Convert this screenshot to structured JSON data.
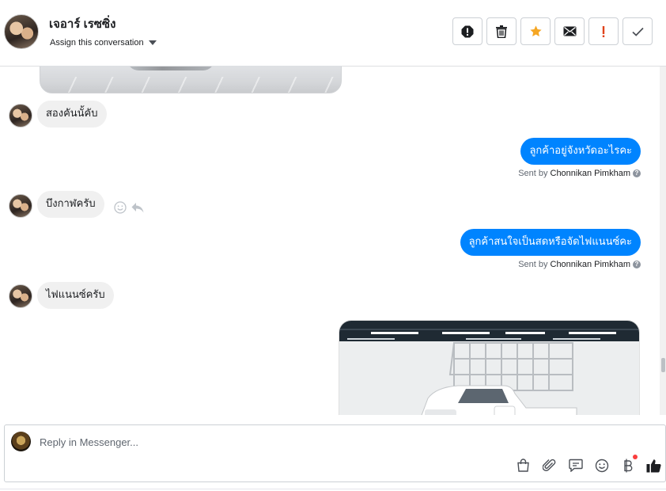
{
  "header": {
    "contact_name": "เจอาร์ เรซซิ่ง",
    "assign_label": "Assign this conversation",
    "actions": [
      {
        "name": "mark-spam-icon"
      },
      {
        "name": "trash-icon"
      },
      {
        "name": "star-icon"
      },
      {
        "name": "mark-unread-icon"
      },
      {
        "name": "follow-up-icon"
      },
      {
        "name": "mark-done-icon"
      }
    ]
  },
  "messages": [
    {
      "from": "customer",
      "text": "สองคันนั้คับ"
    },
    {
      "from": "page",
      "text": "ลูกค้าอยู่จังหวัดอะไรคะ",
      "sent_by_prefix": "Sent by",
      "sent_by_name": "Chonnikan Pimkham"
    },
    {
      "from": "customer",
      "text": "บึงกาฬครับ"
    },
    {
      "from": "page",
      "text": "ลูกค้าสนใจเป็นสดหรือจัดไฟแนนซ์คะ",
      "sent_by_prefix": "Sent by",
      "sent_by_name": "Chonnikan Pimkham"
    },
    {
      "from": "customer",
      "text": "ไฟแนนซ์ครับ"
    }
  ],
  "composer": {
    "placeholder": "Reply in Messenger...",
    "tools": [
      "shopping-bag-icon",
      "attachment-icon",
      "saved-reply-icon",
      "emoji-icon",
      "payment-icon",
      "like-icon"
    ]
  },
  "colors": {
    "outgoing_bubble": "#0084ff",
    "incoming_bubble": "#f0f0f0",
    "star": "#f5a623",
    "alert": "#e0431b"
  }
}
